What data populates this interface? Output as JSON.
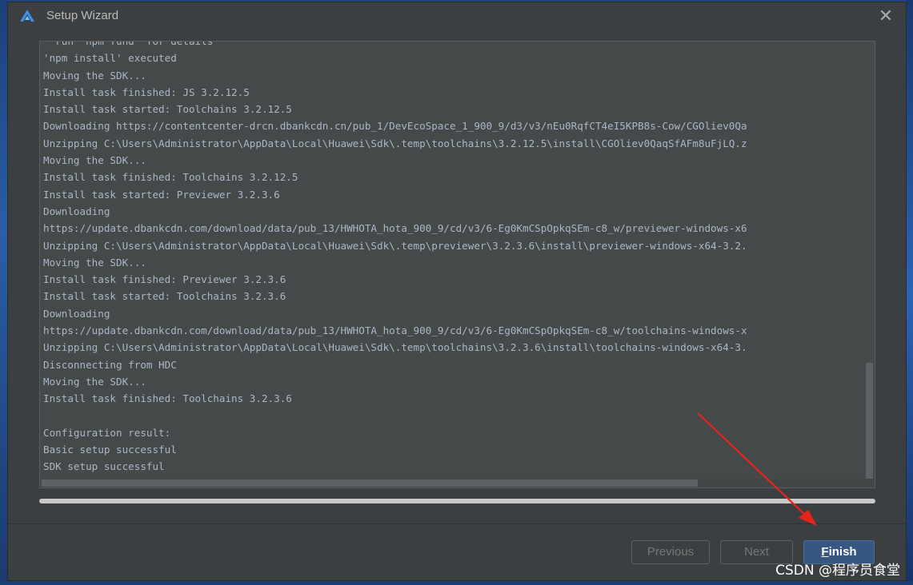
{
  "window": {
    "title": "Setup Wizard",
    "close_glyph": "✕"
  },
  "log": {
    "lines": [
      "  run `npm fund` for details",
      "'npm install' executed",
      "Moving the SDK...",
      "Install task finished: JS 3.2.12.5",
      "Install task started: Toolchains 3.2.12.5",
      "Downloading https://contentcenter-drcn.dbankcdn.cn/pub_1/DevEcoSpace_1_900_9/d3/v3/nEu0RqfCT4eI5KPB8s-Cow/CGOliev0Qa",
      "Unzipping C:\\Users\\Administrator\\AppData\\Local\\Huawei\\Sdk\\.temp\\toolchains\\3.2.12.5\\install\\CGOliev0QaqSfAFm8uFjLQ.z",
      "Moving the SDK...",
      "Install task finished: Toolchains 3.2.12.5",
      "Install task started: Previewer 3.2.3.6",
      "Downloading",
      "https://update.dbankcdn.com/download/data/pub_13/HWHOTA_hota_900_9/cd/v3/6-Eg0KmCSpOpkqSEm-c8_w/previewer-windows-x6",
      "Unzipping C:\\Users\\Administrator\\AppData\\Local\\Huawei\\Sdk\\.temp\\previewer\\3.2.3.6\\install\\previewer-windows-x64-3.2.",
      "Moving the SDK...",
      "Install task finished: Previewer 3.2.3.6",
      "Install task started: Toolchains 3.2.3.6",
      "Downloading",
      "https://update.dbankcdn.com/download/data/pub_13/HWHOTA_hota_900_9/cd/v3/6-Eg0KmCSpOpkqSEm-c8_w/toolchains-windows-x",
      "Unzipping C:\\Users\\Administrator\\AppData\\Local\\Huawei\\Sdk\\.temp\\toolchains\\3.2.3.6\\install\\toolchains-windows-x64-3.",
      "Disconnecting from HDC",
      "Moving the SDK...",
      "Install task finished: Toolchains 3.2.3.6",
      "",
      "Configuration result:",
      "Basic setup successful",
      "SDK setup successful"
    ]
  },
  "progress": {
    "value": 1.0
  },
  "buttons": {
    "previous": "Previous",
    "next": "Next",
    "finish_mnemonic": "F",
    "finish_rest": "inish"
  },
  "watermark": "CSDN @程序员食堂",
  "colors": {
    "dialog_bg": "#3c3f41",
    "log_bg": "#45494a",
    "log_text": "#a9b7c6",
    "accent_button": "#365880",
    "annotation_arrow": "#e8231b"
  }
}
